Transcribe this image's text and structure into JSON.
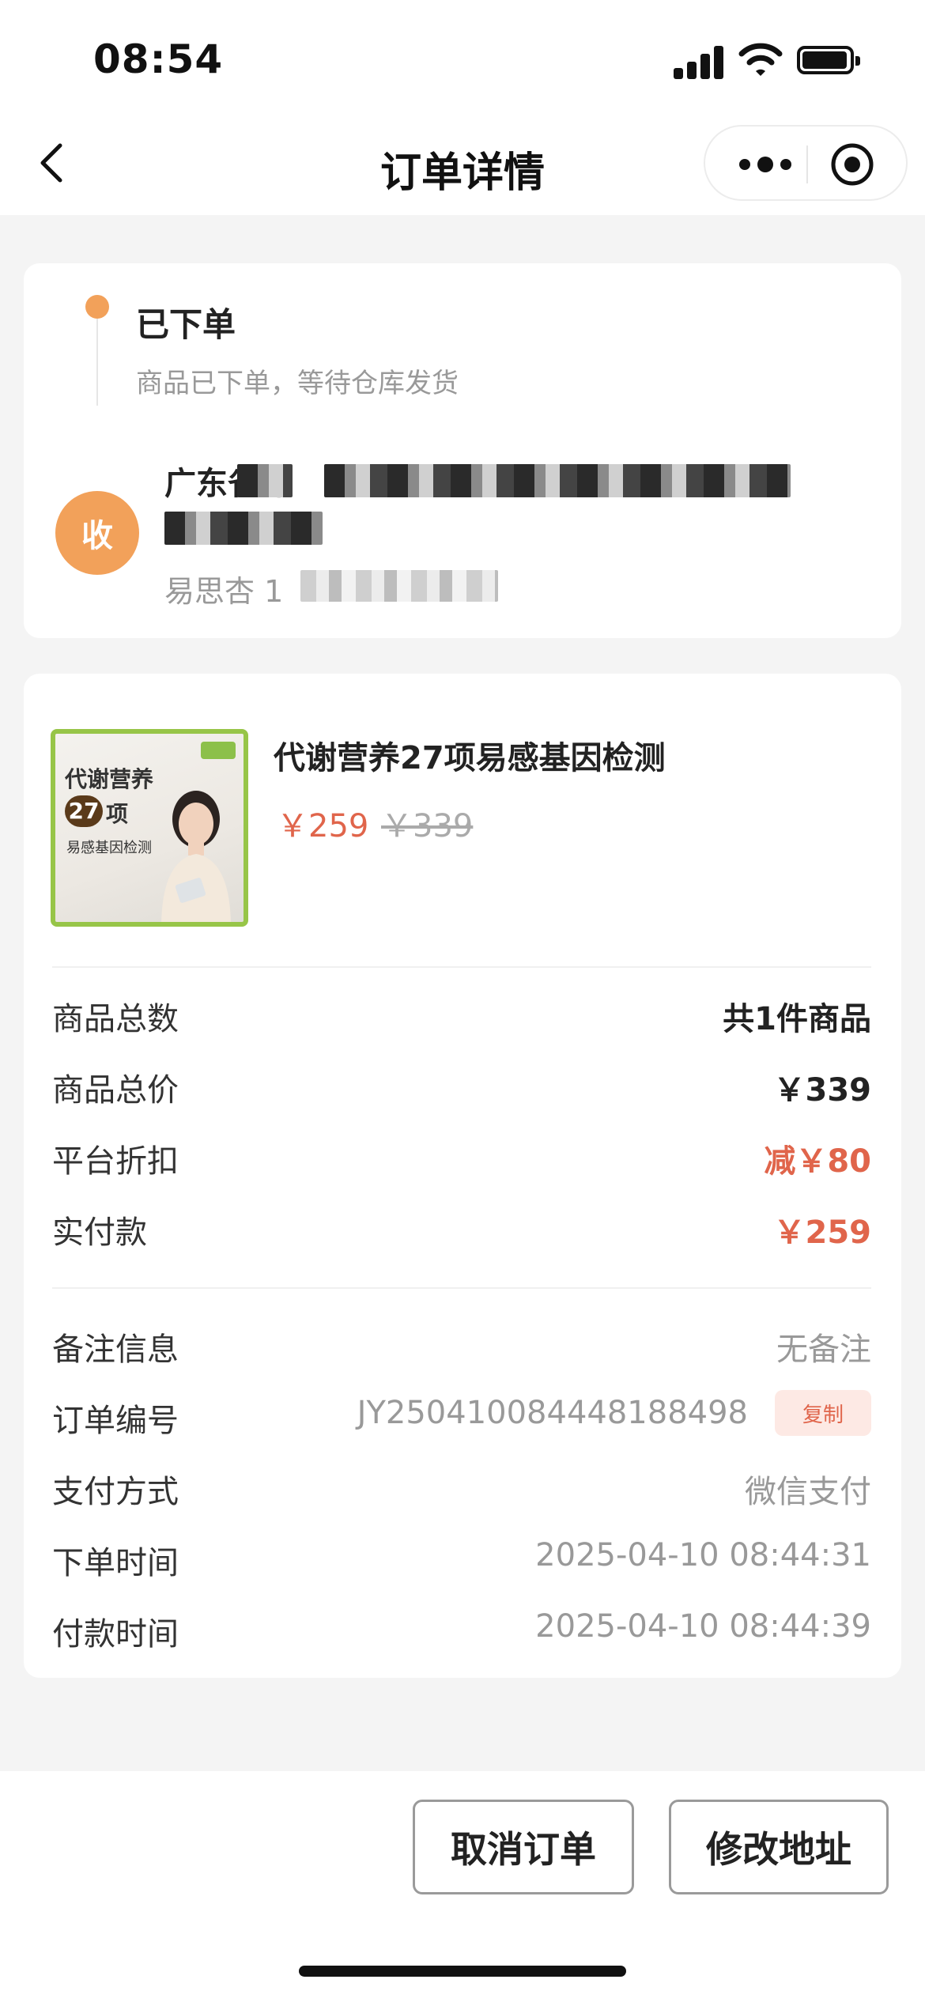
{
  "status_bar": {
    "time": "08:54"
  },
  "nav": {
    "title": "订单详情"
  },
  "order_status": {
    "title": "已下单",
    "desc": "商品已下单，等待仓库发货"
  },
  "receiver": {
    "badge": "收",
    "address": "广东省深",
    "contact": "易思杏 1"
  },
  "product": {
    "image_text": {
      "line1": "代谢营养",
      "num": "27",
      "line2": "项",
      "line3": "易感基因检测"
    },
    "name": "代谢营养27项易感基因检测",
    "price": "￥259",
    "original_price": "￥339"
  },
  "summary": [
    {
      "label": "商品总数",
      "value": "共1件商品"
    },
    {
      "label": "商品总价",
      "value": "￥339"
    },
    {
      "label": "平台折扣",
      "value": "减￥80"
    },
    {
      "label": "实付款",
      "value": "￥259"
    }
  ],
  "details": {
    "remark": {
      "label": "备注信息",
      "value": "无备注"
    },
    "order_no": {
      "label": "订单编号",
      "value": "JY250410084448188498",
      "copy_label": "复制"
    },
    "pay_method": {
      "label": "支付方式",
      "value": "微信支付"
    },
    "order_time": {
      "label": "下单时间",
      "value": "2025-04-10 08:44:31"
    },
    "pay_time": {
      "label": "付款时间",
      "value": "2025-04-10 08:44:39"
    }
  },
  "actions": {
    "cancel": "取消订单",
    "change_address": "修改地址"
  },
  "colors": {
    "accent_orange": "#f2a15a",
    "price_red": "#e0654b",
    "copy_bg": "#fde9e4"
  }
}
